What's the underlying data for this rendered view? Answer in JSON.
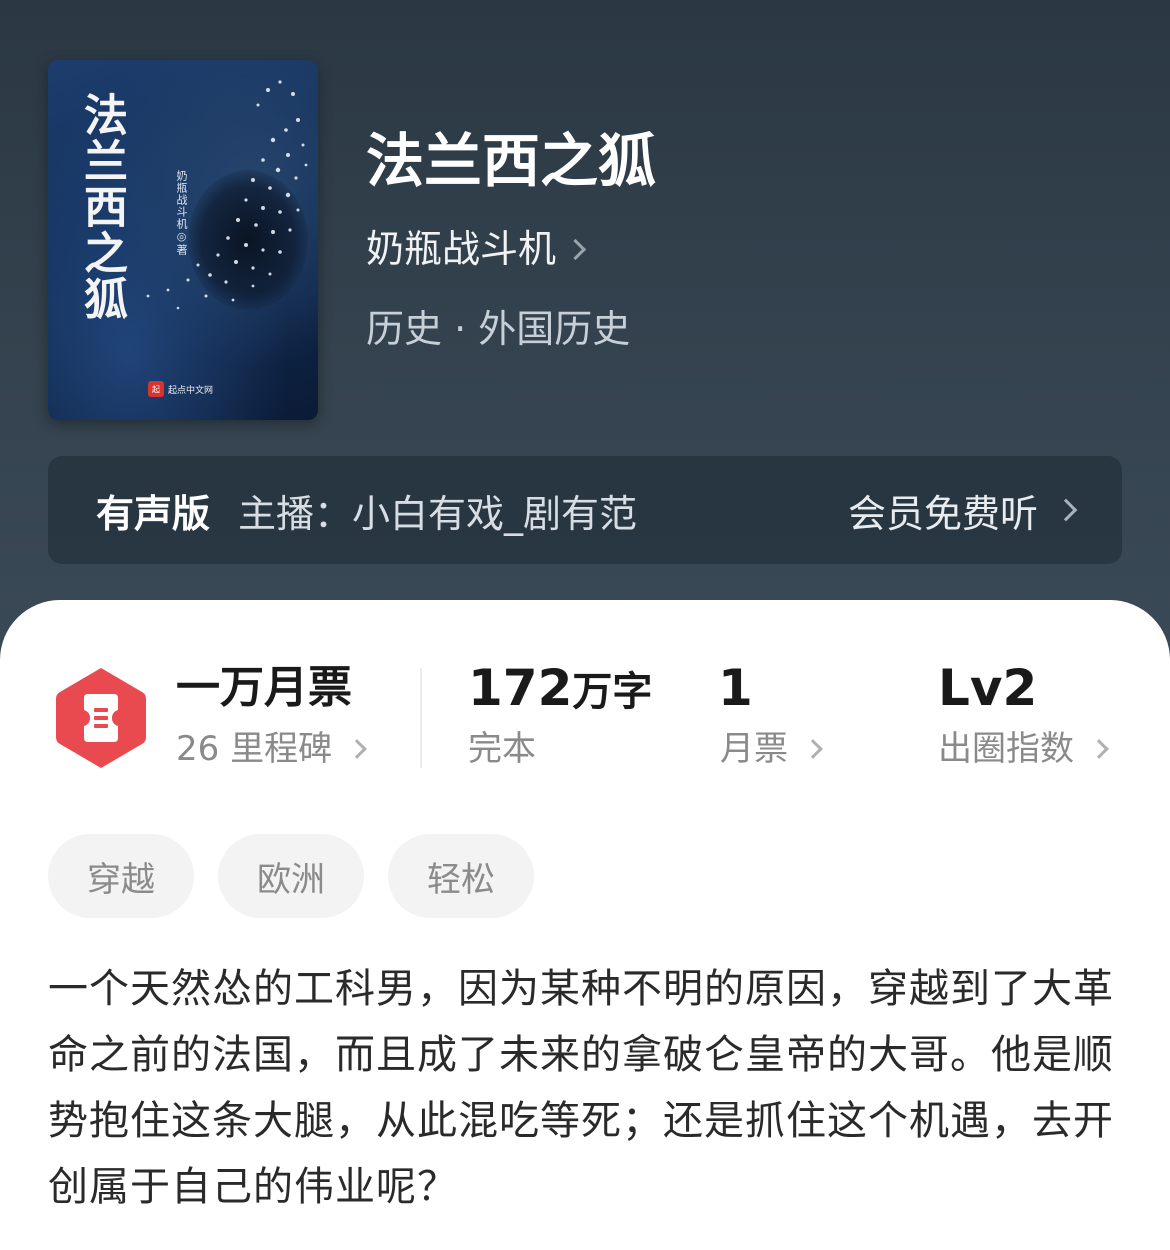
{
  "book": {
    "cover_title": "法兰西之狐",
    "cover_author": "奶瓶战斗机◎著",
    "cover_publisher": "起点中文网",
    "cover_publisher_mark": "起",
    "title": "法兰西之狐",
    "author": "奶瓶战斗机",
    "category": "历史 · 外国历史"
  },
  "audio": {
    "label": "有声版",
    "host": "主播：小白有戏_剧有范",
    "cta": "会员免费听"
  },
  "stats": {
    "votes_main": "一万月票",
    "votes_sub": "26 里程碑",
    "words_number": "172",
    "words_unit": "万字",
    "words_sub": "完本",
    "monthly_number": "1",
    "monthly_sub": "月票",
    "level_main": "Lv2",
    "level_sub": "出圈指数"
  },
  "tags": [
    "穿越",
    "欧洲",
    "轻松"
  ],
  "synopsis": "一个天然怂的工科男，因为某种不明的原因，穿越到了大革命之前的法国，而且成了未来的拿破仑皇帝的大哥。他是顺势抱住这条大腿，从此混吃等死；还是抓住这个机遇，去开创属于自己的伟业呢？",
  "icons": {
    "badge": "ticket-hexagon-icon",
    "chevron": "chevron-right-icon"
  },
  "colors": {
    "badge": "#e84a4f",
    "hero_bg": "#2f3d49"
  }
}
